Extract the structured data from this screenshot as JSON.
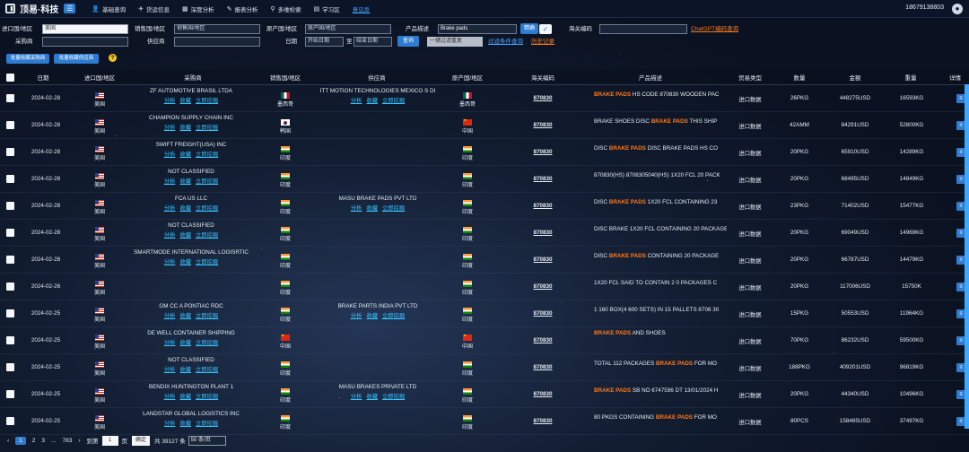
{
  "app": {
    "title": "顶易·科技",
    "phone": "18679138803"
  },
  "nav": [
    {
      "icon": "user-icon",
      "glyph": "👤",
      "label": "基础查询"
    },
    {
      "icon": "plane-icon",
      "glyph": "✈",
      "label": "货运信息"
    },
    {
      "icon": "chart-icon",
      "glyph": "▦",
      "label": "深度分析"
    },
    {
      "icon": "report-icon",
      "glyph": "✎",
      "label": "报表分析"
    },
    {
      "icon": "search-icon",
      "glyph": "⚲",
      "label": "多维检索"
    },
    {
      "icon": "book-icon",
      "glyph": "▤",
      "label": "学习区"
    },
    {
      "icon": "",
      "glyph": "",
      "label": "意见反"
    }
  ],
  "filters": {
    "import_country_label": "进口国/地区",
    "import_country_value": "美国",
    "sales_country_label": "销售国/地区",
    "sales_country_placeholder": "销售国/地区",
    "origin_country_label": "原产国/地区",
    "origin_country_placeholder": "原产国/地区",
    "product_label": "产品描述",
    "product_value": "Brake pads",
    "precise_label": "精确",
    "hs_label": "海关编码",
    "chatgpt_link": "ChatGPT编码查询",
    "buyer_label": "采购商",
    "supplier_label": "供应商",
    "date_label": "日期",
    "date_start": "开始日期",
    "date_to": "至",
    "date_end": "结束日期",
    "search_button": "查询",
    "dedupe_select": "一键过滤重复",
    "filter_link": "过滤条件查询",
    "history_link": "历史记录"
  },
  "toolbar": {
    "collect_buyer": "批量收藏采购商",
    "collect_supplier": "批量收藏供应商",
    "help": "?"
  },
  "columns": [
    "日期",
    "进口国/地区",
    "采购商",
    "销售国/地区",
    "供应商",
    "原产国/地区",
    "海关编码",
    "产品描述",
    "贸易类型",
    "数量",
    "金额",
    "重量",
    "详情"
  ],
  "actions": [
    "分析",
    "收藏",
    "立即挖掘"
  ],
  "rows": [
    {
      "date": "2024-02-28",
      "imp": "美国",
      "buyer": "ZF AUTOMOTIVE BRASIL LTDA",
      "sales": "墨西哥",
      "sales_flag": "mx",
      "supplier": "ITT MOTION TECHNOLOGIES MEXICO S DI",
      "origin": "墨西哥",
      "origin_flag": "mx",
      "hs": "870830",
      "desc_pre": "",
      "desc_hl": "BRAKE PADS",
      "desc_post": " HS CODE 870830 WOODEN PAC",
      "type": "进口数据",
      "qty": "26PKG",
      "amt": "448275USD",
      "wt": "16593KG"
    },
    {
      "date": "2024-02-28",
      "imp": "美国",
      "buyer": "CHAMPION SUPPLY CHAIN INC",
      "sales": "韩国",
      "sales_flag": "kr",
      "supplier": "",
      "origin": "中国",
      "origin_flag": "cn",
      "hs": "870830",
      "desc_pre": "BRAKE SHOES DISC ",
      "desc_hl": "BRAKE PADS",
      "desc_post": " THIS SHIP",
      "type": "进口数据",
      "qty": "42AMM",
      "amt": "84291USD",
      "wt": "52800KG"
    },
    {
      "date": "2024-02-28",
      "imp": "美国",
      "buyer": "SWIFT FREIGHT(USA) INC",
      "sales": "印度",
      "sales_flag": "in",
      "supplier": "",
      "origin": "印度",
      "origin_flag": "in",
      "hs": "870830",
      "desc_pre": "DISC ",
      "desc_hl": "BRAKE PADS",
      "desc_post": " DISC BRAKE PADS HS CO",
      "type": "进口数据",
      "qty": "20PKG",
      "amt": "65910USD",
      "wt": "14289KG"
    },
    {
      "date": "2024-02-28",
      "imp": "美国",
      "buyer": "NOT CLASSIFIED",
      "sales": "印度",
      "sales_flag": "in",
      "supplier": "",
      "origin": "印度",
      "origin_flag": "in",
      "hs": "870830",
      "desc_pre": "870830(HS) 8708305040(HS) 1X20 FCL 20 PACK",
      "desc_hl": "",
      "desc_post": "",
      "type": "进口数据",
      "qty": "20PKG",
      "amt": "68495USD",
      "wt": "14849KG"
    },
    {
      "date": "2024-02-28",
      "imp": "美国",
      "buyer": "FCA US LLC",
      "sales": "印度",
      "sales_flag": "in",
      "supplier": "MASU BRAKE PADS PVT LTD",
      "origin": "印度",
      "origin_flag": "in",
      "hs": "870830",
      "desc_pre": "DISC ",
      "desc_hl": "BRAKE PADS",
      "desc_post": " 1X20 FCL CONTAINING 23",
      "type": "进口数据",
      "qty": "23PKG",
      "amt": "71402USD",
      "wt": "15477KG"
    },
    {
      "date": "2024-02-28",
      "imp": "美国",
      "buyer": "NOT CLASSIFIED",
      "sales": "印度",
      "sales_flag": "in",
      "supplier": "",
      "origin": "印度",
      "origin_flag": "in",
      "hs": "870830",
      "desc_pre": "DISC BRAKE 1X20 FCL CONTAINING 20 PACKAGE",
      "desc_hl": "",
      "desc_post": "",
      "type": "进口数据",
      "qty": "20PKG",
      "amt": "69049USD",
      "wt": "14969KG"
    },
    {
      "date": "2024-02-28",
      "imp": "美国",
      "buyer": "SMARTMODE INTERNATIONAL LOGISRTIC",
      "sales": "印度",
      "sales_flag": "in",
      "supplier": "",
      "origin": "印度",
      "origin_flag": "in",
      "hs": "870830",
      "desc_pre": "DISC ",
      "desc_hl": "BRAKE PADS",
      "desc_post": " CONTAINING 20 PACKAGE",
      "type": "进口数据",
      "qty": "20PKG",
      "amt": "66787USD",
      "wt": "14479KG"
    },
    {
      "date": "2024-02-26",
      "imp": "美国",
      "buyer": "",
      "sales": "印度",
      "sales_flag": "in",
      "supplier": "",
      "origin": "印度",
      "origin_flag": "in",
      "hs": "870830",
      "desc_pre": "1X20 FCL SAID TO CONTAIN 2 0 PACKAGES C",
      "desc_hl": "",
      "desc_post": "",
      "type": "进口数据",
      "qty": "20PKG",
      "amt": "117006USD",
      "wt": "15750K"
    },
    {
      "date": "2024-02-25",
      "imp": "美国",
      "buyer": "GM CC A PONTIAC RDC",
      "sales": "印度",
      "sales_flag": "in",
      "supplier": "BRAKE PARTS INDIA PVT LTD",
      "origin": "印度",
      "origin_flag": "in",
      "hs": "870830",
      "desc_pre": "1 160 BOX(4 600 SETS) IN 15 PALLETS 8708 30",
      "desc_hl": "",
      "desc_post": "",
      "type": "进口数据",
      "qty": "15PKG",
      "amt": "50553USD",
      "wt": "11964KG"
    },
    {
      "date": "2024-02-25",
      "imp": "美国",
      "buyer": "DE WELL CONTAINER SHIPPING",
      "sales": "中国",
      "sales_flag": "cn",
      "supplier": "",
      "origin": "中国",
      "origin_flag": "cn",
      "hs": "870830",
      "desc_pre": "",
      "desc_hl": "BRAKE PADS",
      "desc_post": " AND SHOES",
      "type": "进口数据",
      "qty": "70PKG",
      "amt": "86232USD",
      "wt": "59500KG"
    },
    {
      "date": "2024-02-25",
      "imp": "美国",
      "buyer": "NOT CLASSIFIED",
      "sales": "印度",
      "sales_flag": "in",
      "supplier": "",
      "origin": "印度",
      "origin_flag": "in",
      "hs": "870830",
      "desc_pre": "TOTAL 112 PACKAGES ",
      "desc_hl": "BRAKE PADS",
      "desc_post": " FOR MO",
      "type": "进口数据",
      "qty": "188PKG",
      "amt": "409201USD",
      "wt": "96819KG"
    },
    {
      "date": "2024-02-25",
      "imp": "美国",
      "buyer": "BENDIX HUNTINGTON PLANT 1",
      "sales": "印度",
      "sales_flag": "in",
      "supplier": "MASU BRAKES PRIVATE LTD",
      "origin": "印度",
      "origin_flag": "in",
      "hs": "870830",
      "desc_pre": "",
      "desc_hl": "BRAKE PADS",
      "desc_post": " SB NO 6747596 DT 13/01/2024 H",
      "type": "进口数据",
      "qty": "20PKG",
      "amt": "44340USD",
      "wt": "10496KG"
    },
    {
      "date": "2024-02-25",
      "imp": "美国",
      "buyer": "LANDSTAR GLOBAL LOGISTICS INC",
      "sales": "印度",
      "sales_flag": "in",
      "supplier": "",
      "origin": "印度",
      "origin_flag": "in",
      "hs": "870830",
      "desc_pre": "80 PKGS CONTAINING ",
      "desc_hl": "BRAKE PADS",
      "desc_post": " FOR MO",
      "type": "进口数据",
      "qty": "80PCS",
      "amt": "158465USD",
      "wt": "37497KG"
    }
  ],
  "pager": {
    "pages": [
      "1",
      "2",
      "3",
      "...",
      "783"
    ],
    "goto_label": "到第",
    "goto_value": "1",
    "page_unit": "页",
    "confirm": "确定",
    "total": "共 39127 条",
    "page_size": "50 条/页"
  },
  "colors": {
    "accent": "#2e7bcf",
    "highlight": "#ff7a1a",
    "link": "#35c2ff"
  }
}
